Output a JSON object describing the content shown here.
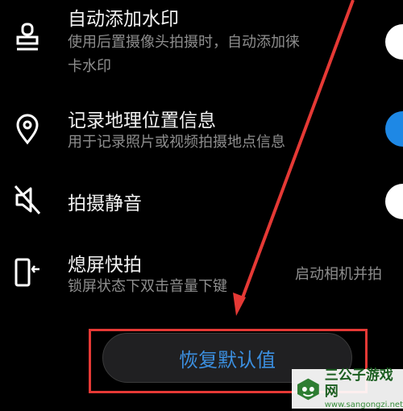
{
  "settings": [
    {
      "title": "自动添加水印",
      "subtitle": "使用后置摄像头拍摄时，自动添加徕卡水印",
      "subtitle_lines": [
        "使用后置摄像头拍摄时，自动添加徕",
        "卡水印"
      ],
      "icon": "stamp-icon",
      "toggle": "off"
    },
    {
      "title": "记录地理位置信息",
      "subtitle": "用于记录照片或视频拍摄地点信息",
      "icon": "location-pin-icon",
      "toggle": "on"
    },
    {
      "title": "拍摄静音",
      "icon": "speaker-mute-icon",
      "toggle": "off"
    },
    {
      "title": "熄屏快拍",
      "subtitle": "锁屏状态下双击音量下键",
      "value": "启动相机并拍",
      "icon": "screen-off-snap-icon"
    }
  ],
  "reset_button": {
    "label": "恢复默认值"
  },
  "colors": {
    "accent": "#1e88e5",
    "highlight": "#e53935",
    "button_text": "#3b8fe0"
  },
  "watermark": {
    "name": "三公子游戏网",
    "url": "www.sangongzi.net"
  }
}
